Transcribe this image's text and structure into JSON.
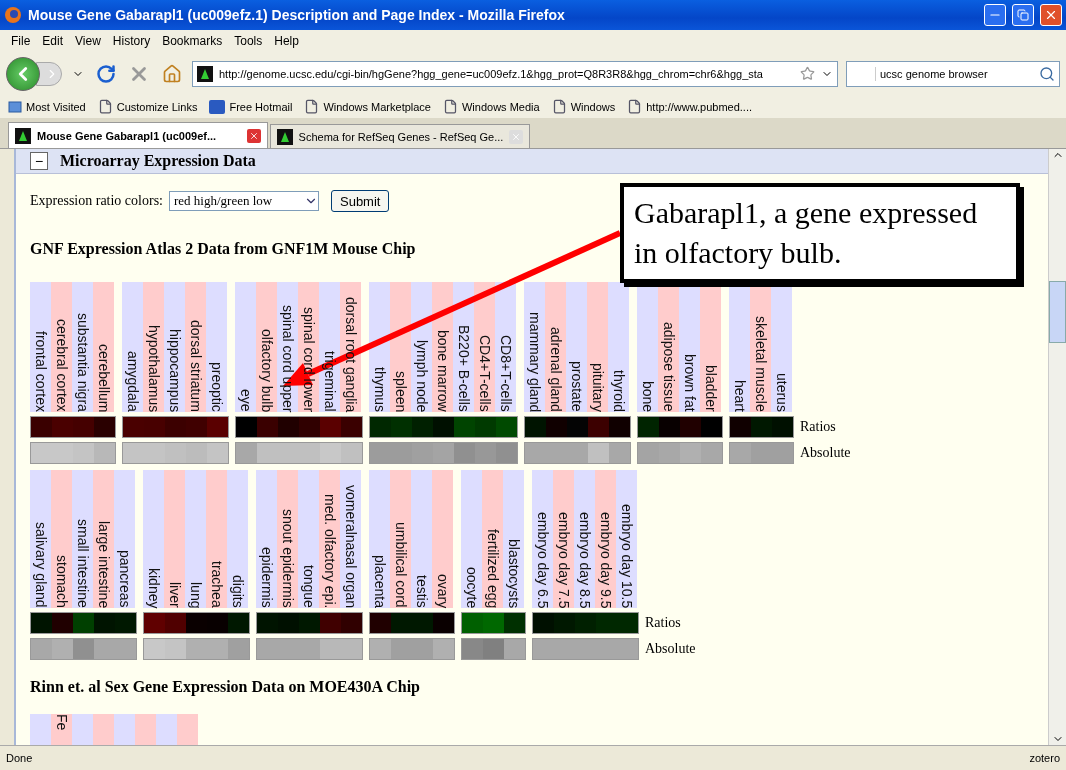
{
  "window": {
    "title": "Mouse Gene Gabarapl1 (uc009efz.1) Description and Page Index - Mozilla Firefox"
  },
  "menu": [
    "File",
    "Edit",
    "View",
    "History",
    "Bookmarks",
    "Tools",
    "Help"
  ],
  "toolbar": {
    "url": "http://genome.ucsc.edu/cgi-bin/hgGene?hgg_gene=uc009efz.1&hgg_prot=Q8R3R8&hgg_chrom=chr6&hgg_sta",
    "search_value": "ucsc genome browser"
  },
  "bookmarks": [
    {
      "label": "Most Visited",
      "kind": "special"
    },
    {
      "label": "Customize Links",
      "kind": "page"
    },
    {
      "label": "Free Hotmail",
      "kind": "hotmail"
    },
    {
      "label": "Windows Marketplace",
      "kind": "page"
    },
    {
      "label": "Windows Media",
      "kind": "page"
    },
    {
      "label": "Windows",
      "kind": "page"
    },
    {
      "label": "http://www.pubmed....",
      "kind": "page"
    }
  ],
  "tabs": [
    {
      "label": "Mouse Gene Gabarapl1 (uc009ef...",
      "selected": true
    },
    {
      "label": "Schema for RefSeq Genes - RefSeq Ge...",
      "selected": false
    }
  ],
  "section": {
    "toggle": "−",
    "title": "Microarray Expression Data"
  },
  "controls": {
    "label": "Expression ratio colors:",
    "select_value": "red high/green low",
    "button": "Submit"
  },
  "atlas": {
    "title": "GNF Expression Atlas 2 Data from GNF1M Mouse Chip",
    "blocks": [
      {
        "row_labels": [
          "Ratios",
          "Absolute"
        ],
        "groups": [
          {
            "tissues": [
              {
                "name": "frontal cortex",
                "ratio": {
                  "color": "#3a0000"
                },
                "absolute": {
                  "color": "#c8c8c8"
                }
              },
              {
                "name": "cerebral cortex",
                "ratio": {
                  "color": "#4a0000"
                },
                "absolute": {
                  "color": "#c8c8c8"
                }
              },
              {
                "name": "substantia nigra",
                "ratio": {
                  "color": "#450000"
                },
                "absolute": {
                  "color": "#c4c4c4"
                }
              },
              {
                "name": "cerebellum",
                "ratio": {
                  "color": "#2a0000"
                },
                "absolute": {
                  "color": "#b8b8b8"
                }
              }
            ]
          },
          {
            "tissues": [
              {
                "name": "amygdala",
                "ratio": {
                  "color": "#4a0000"
                },
                "absolute": {
                  "color": "#c4c4c4"
                }
              },
              {
                "name": "hypothalamus",
                "ratio": {
                  "color": "#480000"
                },
                "absolute": {
                  "color": "#c4c4c4"
                }
              },
              {
                "name": "hippocampus",
                "ratio": {
                  "color": "#3c0000"
                },
                "absolute": {
                  "color": "#c0c0c0"
                }
              },
              {
                "name": "dorsal striatum",
                "ratio": {
                  "color": "#400000"
                },
                "absolute": {
                  "color": "#bcbcbc"
                }
              },
              {
                "name": "preoptic",
                "ratio": {
                  "color": "#5a0000"
                },
                "absolute": {
                  "color": "#c4c4c4"
                }
              }
            ]
          },
          {
            "tissues": [
              {
                "name": "eye",
                "ratio": {
                  "color": "#000000"
                },
                "absolute": {
                  "color": "#a8a8a8"
                }
              },
              {
                "name": "olfactory bulb",
                "ratio": {
                  "color": "#3a0000"
                },
                "absolute": {
                  "color": "#c0c0c0"
                }
              },
              {
                "name": "spinal cord upper",
                "ratio": {
                  "color": "#200000"
                },
                "absolute": {
                  "color": "#c0c0c0"
                }
              },
              {
                "name": "spinal cord lower",
                "ratio": {
                  "color": "#300000"
                },
                "absolute": {
                  "color": "#c0c0c0"
                }
              },
              {
                "name": "trigeminal",
                "ratio": {
                  "color": "#5a0000"
                },
                "absolute": {
                  "color": "#c8c8c8"
                }
              },
              {
                "name": "dorsal root ganglia",
                "ratio": {
                  "color": "#3a0000"
                },
                "absolute": {
                  "color": "#c0c0c0"
                }
              }
            ]
          },
          {
            "tissues": [
              {
                "name": "thymus",
                "ratio": {
                  "color": "#002800"
                },
                "absolute": {
                  "color": "#9c9c9c"
                }
              },
              {
                "name": "spleen",
                "ratio": {
                  "color": "#003000"
                },
                "absolute": {
                  "color": "#9c9c9c"
                }
              },
              {
                "name": "lymph node",
                "ratio": {
                  "color": "#002000"
                },
                "absolute": {
                  "color": "#a0a0a0"
                }
              },
              {
                "name": "bone marrow",
                "ratio": {
                  "color": "#001000"
                },
                "absolute": {
                  "color": "#a4a4a4"
                }
              },
              {
                "name": "B220+ B-cells",
                "ratio": {
                  "color": "#004400"
                },
                "absolute": {
                  "color": "#909090"
                }
              },
              {
                "name": "CD4+T-cells",
                "ratio": {
                  "color": "#003a00"
                },
                "absolute": {
                  "color": "#989898"
                }
              },
              {
                "name": "CD8+T-cells",
                "ratio": {
                  "color": "#004a00"
                },
                "absolute": {
                  "color": "#909090"
                }
              }
            ]
          },
          {
            "tissues": [
              {
                "name": "mammary gland",
                "ratio": {
                  "color": "#001400"
                },
                "absolute": {
                  "color": "#a8a8a8"
                }
              },
              {
                "name": "adrenal gland",
                "ratio": {
                  "color": "#100000"
                },
                "absolute": {
                  "color": "#a8a8a8"
                }
              },
              {
                "name": "prostate",
                "ratio": {
                  "color": "#040404"
                },
                "absolute": {
                  "color": "#a8a8a8"
                }
              },
              {
                "name": "pituitary",
                "ratio": {
                  "color": "#3c0000"
                },
                "absolute": {
                  "color": "#c0c0c0"
                }
              },
              {
                "name": "thyroid",
                "ratio": {
                  "color": "#100000"
                },
                "absolute": {
                  "color": "#a8a8a8"
                }
              }
            ]
          },
          {
            "tissues": [
              {
                "name": "bone",
                "ratio": {
                  "color": "#002400"
                },
                "absolute": {
                  "color": "#a4a4a4"
                }
              },
              {
                "name": "adipose tissue",
                "ratio": {
                  "color": "#080000"
                },
                "absolute": {
                  "color": "#a8a8a8"
                }
              },
              {
                "name": "brown fat",
                "ratio": {
                  "color": "#200000"
                },
                "absolute": {
                  "color": "#b0b0b0"
                }
              },
              {
                "name": "bladder",
                "ratio": {
                  "color": "#000000"
                },
                "absolute": {
                  "color": "#a8a8a8"
                }
              }
            ]
          },
          {
            "tissues": [
              {
                "name": "heart",
                "ratio": {
                  "color": "#100000"
                },
                "absolute": {
                  "color": "#a8a8a8"
                }
              },
              {
                "name": "skeletal muscle",
                "ratio": {
                  "color": "#001800"
                },
                "absolute": {
                  "color": "#a0a0a0"
                }
              },
              {
                "name": "uterus",
                "ratio": {
                  "color": "#001000"
                },
                "absolute": {
                  "color": "#a0a0a0"
                }
              }
            ]
          }
        ]
      },
      {
        "row_labels": [
          "Ratios",
          "Absolute"
        ],
        "groups": [
          {
            "tissues": [
              {
                "name": "salivary gland",
                "ratio": {
                  "color": "#001400"
                },
                "absolute": {
                  "color": "#a8a8a8"
                }
              },
              {
                "name": "stomach",
                "ratio": {
                  "color": "#200000"
                },
                "absolute": {
                  "color": "#b0b0b0"
                }
              },
              {
                "name": "small intestine",
                "ratio": {
                  "color": "#004000"
                },
                "absolute": {
                  "color": "#909090"
                }
              },
              {
                "name": "large intestine",
                "ratio": {
                  "color": "#001400"
                },
                "absolute": {
                  "color": "#a8a8a8"
                }
              },
              {
                "name": "pancreas",
                "ratio": {
                  "color": "#001800"
                },
                "absolute": {
                  "color": "#a8a8a8"
                }
              }
            ]
          },
          {
            "tissues": [
              {
                "name": "kidney",
                "ratio": {
                  "color": "#600000"
                },
                "absolute": {
                  "color": "#c8c8c8"
                }
              },
              {
                "name": "liver",
                "ratio": {
                  "color": "#500000"
                },
                "absolute": {
                  "color": "#c4c4c4"
                }
              },
              {
                "name": "lung",
                "ratio": {
                  "color": "#0a0000"
                },
                "absolute": {
                  "color": "#b0b0b0"
                }
              },
              {
                "name": "trachea",
                "ratio": {
                  "color": "#080000"
                },
                "absolute": {
                  "color": "#b0b0b0"
                }
              },
              {
                "name": "digits",
                "ratio": {
                  "color": "#001800"
                },
                "absolute": {
                  "color": "#a0a0a0"
                }
              }
            ]
          },
          {
            "tissues": [
              {
                "name": "epidermis",
                "ratio": {
                  "color": "#001400"
                },
                "absolute": {
                  "color": "#a8a8a8"
                }
              },
              {
                "name": "snout epidermis",
                "ratio": {
                  "color": "#001000"
                },
                "absolute": {
                  "color": "#a8a8a8"
                }
              },
              {
                "name": "tongue",
                "ratio": {
                  "color": "#001800"
                },
                "absolute": {
                  "color": "#a8a8a8"
                }
              },
              {
                "name": "med. olfactory epi.",
                "ratio": {
                  "color": "#400000"
                },
                "absolute": {
                  "color": "#b8b8b8"
                }
              },
              {
                "name": "vomeralnasal organ",
                "ratio": {
                  "color": "#300000"
                },
                "absolute": {
                  "color": "#b8b8b8"
                }
              }
            ]
          },
          {
            "tissues": [
              {
                "name": "placenta",
                "ratio": {
                  "color": "#200000"
                },
                "absolute": {
                  "color": "#b0b0b0"
                }
              },
              {
                "name": "umbilical cord",
                "ratio": {
                  "color": "#001800"
                },
                "absolute": {
                  "color": "#a0a0a0"
                }
              },
              {
                "name": "testis",
                "ratio": {
                  "color": "#001800"
                },
                "absolute": {
                  "color": "#a0a0a0"
                }
              },
              {
                "name": "ovary",
                "ratio": {
                  "color": "#0a0000"
                },
                "absolute": {
                  "color": "#b0b0b0"
                }
              }
            ]
          },
          {
            "tissues": [
              {
                "name": "oocyte",
                "ratio": {
                  "color": "#006000"
                },
                "absolute": {
                  "color": "#888888"
                }
              },
              {
                "name": "fertilized egg",
                "ratio": {
                  "color": "#006800"
                },
                "absolute": {
                  "color": "#808080"
                }
              },
              {
                "name": "blastocysts",
                "ratio": {
                  "color": "#003000"
                },
                "absolute": {
                  "color": "#a8a8a8"
                }
              }
            ]
          },
          {
            "tissues": [
              {
                "name": "embryo day 6.5",
                "ratio": {
                  "color": "#001000"
                },
                "absolute": {
                  "color": "#a8a8a8"
                }
              },
              {
                "name": "embryo day 7.5",
                "ratio": {
                  "color": "#001800"
                },
                "absolute": {
                  "color": "#a8a8a8"
                }
              },
              {
                "name": "embryo day 8.5",
                "ratio": {
                  "color": "#002000"
                },
                "absolute": {
                  "color": "#a8a8a8"
                }
              },
              {
                "name": "embryo day 9.5",
                "ratio": {
                  "color": "#002800"
                },
                "absolute": {
                  "color": "#a8a8a8"
                }
              },
              {
                "name": "embryo day 10.5",
                "ratio": {
                  "color": "#002800"
                },
                "absolute": {
                  "color": "#a8a8a8"
                }
              }
            ]
          }
        ]
      }
    ]
  },
  "rinn": {
    "title": "Rinn et. al Sex Gene Expression Data on MOE430A Chip",
    "columns": [
      "",
      "Fe",
      "",
      "",
      "",
      "",
      "",
      ""
    ]
  },
  "callout": {
    "text": "Gabarapl1, a gene expressed in olfactory bulb."
  },
  "status": {
    "text": "Done",
    "addon": "zotero"
  }
}
